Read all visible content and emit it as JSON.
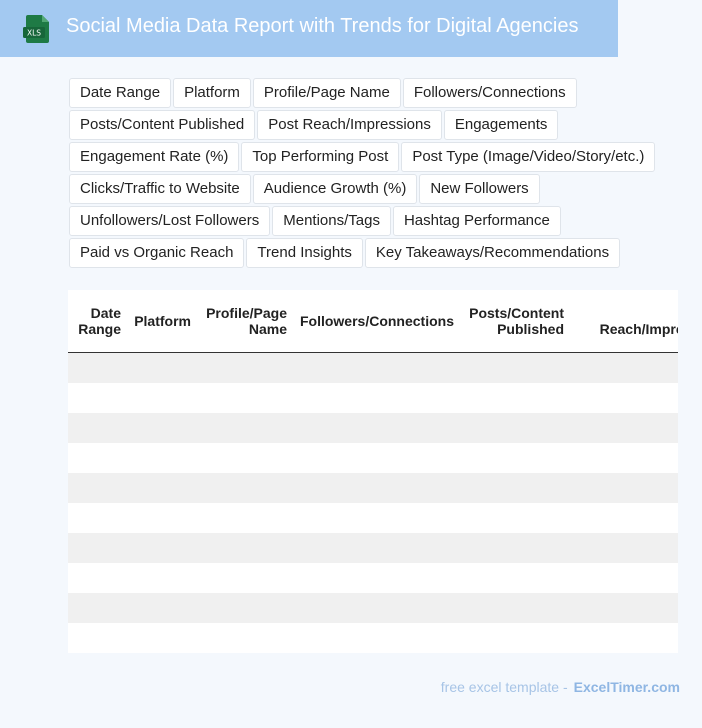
{
  "header": {
    "icon_label": "XLS",
    "title": "Social Media Data Report with Trends for Digital Agencies"
  },
  "tags": [
    [
      "Date Range",
      "Platform",
      "Profile/Page Name",
      "Followers/Connections"
    ],
    [
      "Posts/Content Published",
      "Post Reach/Impressions",
      "Engagements"
    ],
    [
      "Engagement Rate (%)",
      "Top Performing Post",
      "Post Type (Image/Video/Story/etc.)"
    ],
    [
      "Clicks/Traffic to Website",
      "Audience Growth (%)",
      "New Followers"
    ],
    [
      "Unfollowers/Lost Followers",
      "Mentions/Tags",
      "Hashtag Performance"
    ],
    [
      "Paid vs Organic Reach",
      "Trend Insights",
      "Key Takeaways/Recommendations"
    ]
  ],
  "table": {
    "columns": [
      [
        "Date",
        "Range"
      ],
      [
        "Platform"
      ],
      [
        "Profile/Page",
        "Name"
      ],
      [
        "Followers/Connections"
      ],
      [
        "Posts/Content",
        "Published"
      ],
      [
        "Post",
        "Reach/Impressions"
      ]
    ],
    "row_count": 10
  },
  "footer": {
    "text": "free excel template -",
    "brand": "ExcelTimer.com"
  },
  "colors": {
    "header_bg": "#a3c9f1",
    "page_bg": "#f4f8fd",
    "xls_green": "#1e7a45"
  }
}
